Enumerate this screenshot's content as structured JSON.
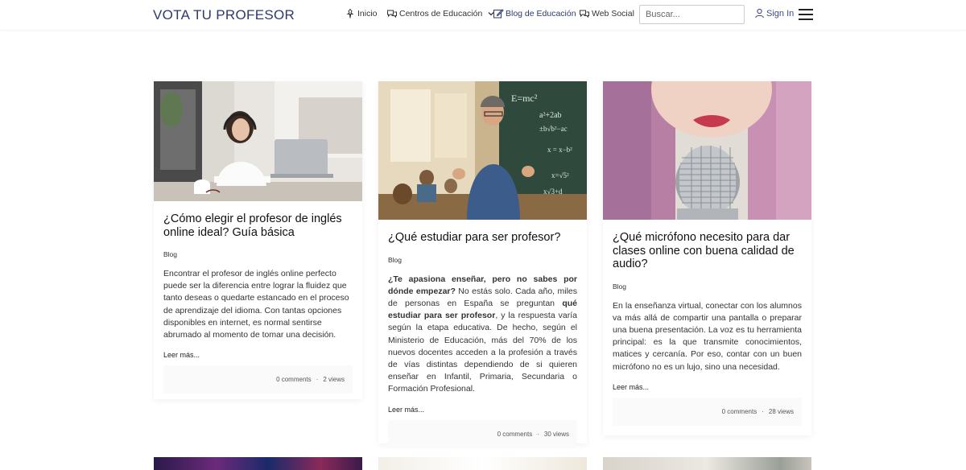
{
  "header": {
    "brand": "VOTA TU PROFESOR",
    "nav": [
      {
        "label": "Inicio"
      },
      {
        "label": "Centros de Educación"
      },
      {
        "label": "Blog de Educación"
      },
      {
        "label": "Web Social"
      }
    ],
    "search_placeholder": "Buscar...",
    "signin": "Sign In"
  },
  "posts": [
    {
      "title": "¿Cómo elegir el profesor de inglés online ideal? Guía básica",
      "category": "Blog",
      "excerpt": "Encontrar el profesor de inglés online perfecto puede ser la diferencia entre lograr la fluidez que tanto deseas o quedarte estancado en el proceso de aprendizaje del idioma. Con tantas opciones disponibles en internet, es normal sentirse abrumado al momento de tomar una decisión.",
      "more": "Leer más...",
      "comments": "0 comments",
      "views": "2 views"
    },
    {
      "title": "¿Qué estudiar para ser profesor?",
      "category": "Blog",
      "excerpt_parts": [
        {
          "text": "¿Te apasiona enseñar, pero no sabes por dónde empezar?",
          "bold": true
        },
        {
          "text": " No estás solo. Cada año, miles de personas en España se preguntan ",
          "bold": false
        },
        {
          "text": "qué estudiar para ser profesor",
          "bold": true
        },
        {
          "text": ", y la respuesta varía según la etapa educativa. De hecho, según el Ministerio de Educación, más del 70% de los nuevos docentes acceden a la profesión a través de vías distintas dependiendo de si quieren enseñar en Infantil, Primaria, Secundaria o Formación Profesional.",
          "bold": false
        }
      ],
      "more": "Leer más...",
      "comments": "0 comments",
      "views": "30 views"
    },
    {
      "title": "¿Qué micrófono necesito para dar clases online con buena calidad de audio?",
      "category": "Blog",
      "excerpt": "En la enseñanza virtual, conectar con los alumnos va más allá de compartir una pantalla o preparar una buena presentación. La voz es tu herramienta principal: es la que transmite conocimientos, matices y cercanía. Por eso, contar con un buen micrófono no es un lujo, sino una necesidad.",
      "more": "Leer más...",
      "comments": "0 comments",
      "views": "28 views"
    }
  ],
  "colors": {
    "brand": "#2d3a6e",
    "signin": "#3b4a8a"
  }
}
